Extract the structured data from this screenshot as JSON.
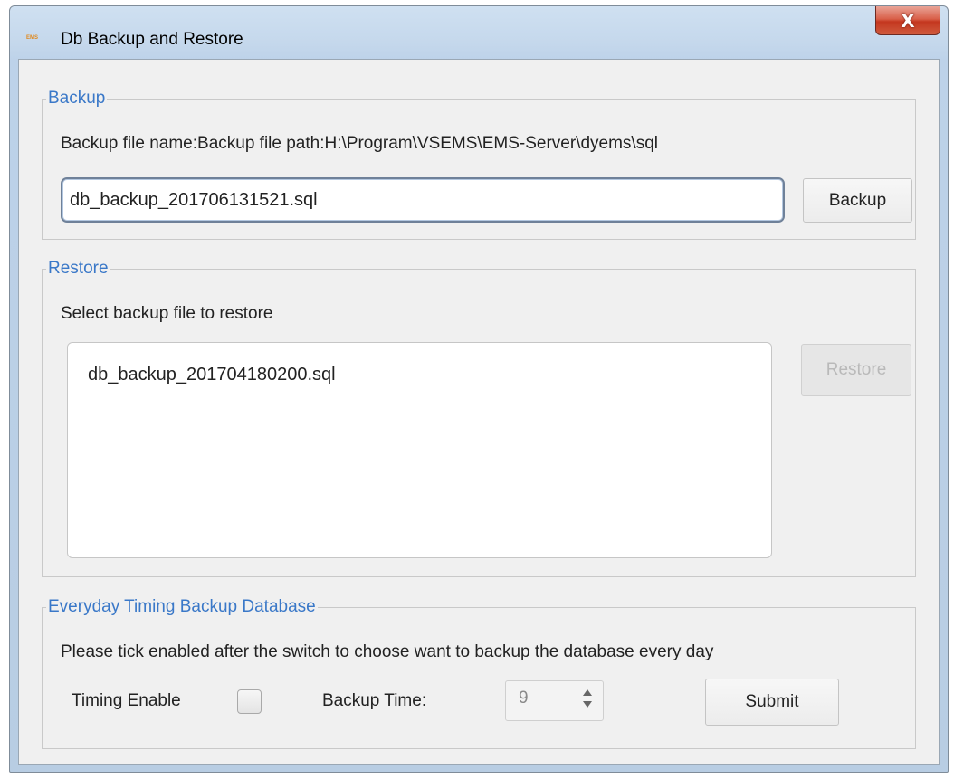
{
  "window": {
    "title": "Db Backup and Restore",
    "icon_text": "EMS",
    "close_glyph": "X"
  },
  "backup": {
    "legend": "Backup",
    "path_label": "Backup file name:Backup file path:H:\\Program\\VSEMS\\EMS-Server\\dyems\\sql",
    "file_name_value": "db_backup_201706131521.sql",
    "button_label": "Backup"
  },
  "restore": {
    "legend": "Restore",
    "instruction": "Select backup file to restore",
    "files": [
      "db_backup_201704180200.sql"
    ],
    "button_label": "Restore",
    "button_enabled": false
  },
  "timing": {
    "legend": "Everyday Timing Backup Database",
    "instruction": "Please tick enabled after the switch to choose want to backup the database every day",
    "enable_label": "Timing Enable",
    "enabled": false,
    "time_label": "Backup Time:",
    "time_value": "9",
    "submit_label": "Submit"
  },
  "colors": {
    "legend_text": "#3a78c8",
    "close_button": "#c4371f",
    "frame": "#c5d8ec"
  }
}
